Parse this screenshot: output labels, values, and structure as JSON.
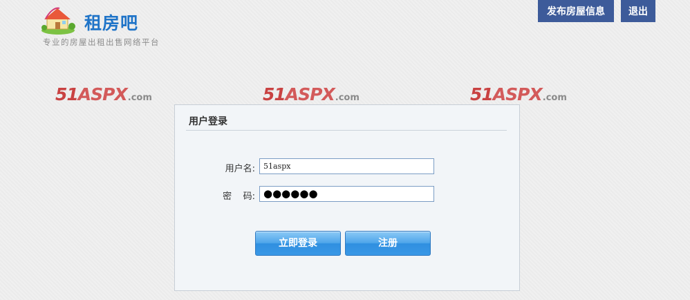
{
  "header": {
    "logo_title": "租房吧",
    "logo_subtitle": "专业的房屋出租出售网络平台",
    "publish_label": "发布房屋信息",
    "logout_label": "退出"
  },
  "watermarks": [
    {
      "main": "51",
      "asp": "ASPX",
      "com": ".com"
    },
    {
      "main": "51",
      "asp": "ASPX",
      "com": ".com"
    },
    {
      "main": "51",
      "asp": "ASPX",
      "com": ".com"
    }
  ],
  "login": {
    "title": "用户登录",
    "username_label": "用户名:",
    "username_value": "51aspx",
    "password_label": "密    码:",
    "password_value": "●●●●●●",
    "login_button": "立即登录",
    "register_button": "注册"
  },
  "colors": {
    "top_button": "#3d5b9a",
    "logo_title": "#1f74c8",
    "primary_button": "#3a98e6"
  }
}
